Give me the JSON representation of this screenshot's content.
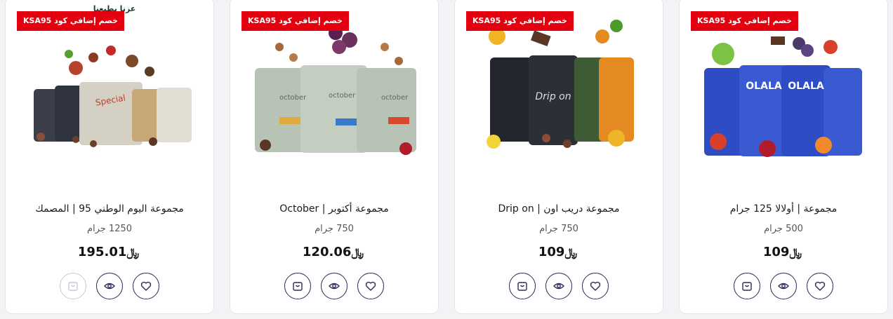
{
  "products": [
    {
      "badge": "خصم إضافي كود KSA95",
      "title": "مجموعة اليوم الوطني 95 | المصمك",
      "weight": "1250 جرام",
      "price": "195.01",
      "currency": "﷼",
      "logo_text": "عزنا بطبعنا",
      "image": "national-day-coffee-bags",
      "colors": [
        "#3a3f4a",
        "#8b4e3b",
        "#d5d0c4",
        "#c7a777"
      ],
      "cart_disabled": true
    },
    {
      "badge": "خصم إضافي كود KSA95",
      "title": "مجموعة أكتوبر | October",
      "weight": "750 جرام",
      "price": "120.06",
      "currency": "﷼",
      "image": "october-coffee-bags",
      "colors": [
        "#b7c3b4",
        "#6a2f5a",
        "#a8683b"
      ],
      "cart_disabled": false
    },
    {
      "badge": "خصم إضافي كود KSA95",
      "title": "مجموعة دريب اون | Drip on",
      "weight": "750 جرام",
      "price": "109",
      "currency": "﷼",
      "image": "drip-on-coffee-bags",
      "colors": [
        "#23262c",
        "#3f5c36",
        "#e58a23"
      ],
      "cart_disabled": false
    },
    {
      "badge": "خصم إضافي كود KSA95",
      "title": "مجموعة | أولالا 125 جرام",
      "weight": "500 جرام",
      "price": "109",
      "currency": "﷼",
      "image": "olala-coffee-bags",
      "colors": [
        "#2e4cc4",
        "#6c8be8",
        "#d9402b"
      ],
      "cart_disabled": false
    }
  ],
  "icons": {
    "cart": "shopping-bag-icon",
    "view": "eye-icon",
    "wishlist": "heart-icon"
  },
  "accent": "#e3000f",
  "button_border": "#2c2a5c"
}
